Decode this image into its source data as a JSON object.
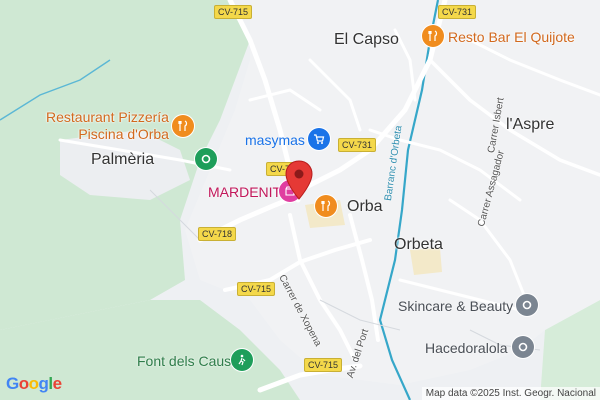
{
  "map": {
    "towns": {
      "el_capso": "El Capso",
      "palmeria": "Palmèria",
      "orba": "Orba",
      "orbeta": "Orbeta",
      "laspre": "l'Aspre"
    },
    "pois": {
      "restaurant_pizzeria_line1": "Restaurant Pizzería",
      "restaurant_pizzeria_line2": "Piscina d'Orba",
      "resto_bar": "Resto Bar El Quijote",
      "masymas": "masymas",
      "mardenit": "MARDENIT",
      "skincare": "Skincare & Beauty",
      "hacedoralola": "Hacedoralola",
      "font_dels_caus": "Font dels Caus"
    },
    "roads": {
      "cv715_top": "CV-715",
      "cv731_top": "CV-731",
      "cv731_mid": "CV-731",
      "cv7_partial": "CV-7",
      "cv718": "CV-718",
      "cv715_mid": "CV-715",
      "cv715_bottom": "CV-715"
    },
    "streets": {
      "carrer_isbert": "Carrer Isbert",
      "carrer_assagador": "Carrer Assagador",
      "carrer_de_xopena": "Carrer de Xopena",
      "av_del_port": "Av. del Port",
      "barranc_dorbeta": "Barranc d'Orbeta"
    },
    "icons": {
      "restaurant": "fork-knife-icon",
      "shopping": "cart-icon",
      "store": "shop-icon",
      "park": "park-icon",
      "place": "place-icon",
      "hiking": "hiking-icon"
    },
    "colors": {
      "poi_orange": "#f08c1e",
      "poi_blue": "#1a73e8",
      "poi_pink": "#e03da0",
      "poi_gray": "#7b8591",
      "poi_green": "#1e9e5a",
      "marker_red": "#e53935",
      "water": "#36a7c9",
      "green_area": "#cfe8d3"
    }
  },
  "footer": {
    "logo_text": "Google",
    "attribution": "Map data ©2025 Inst. Geogr. Nacional"
  }
}
